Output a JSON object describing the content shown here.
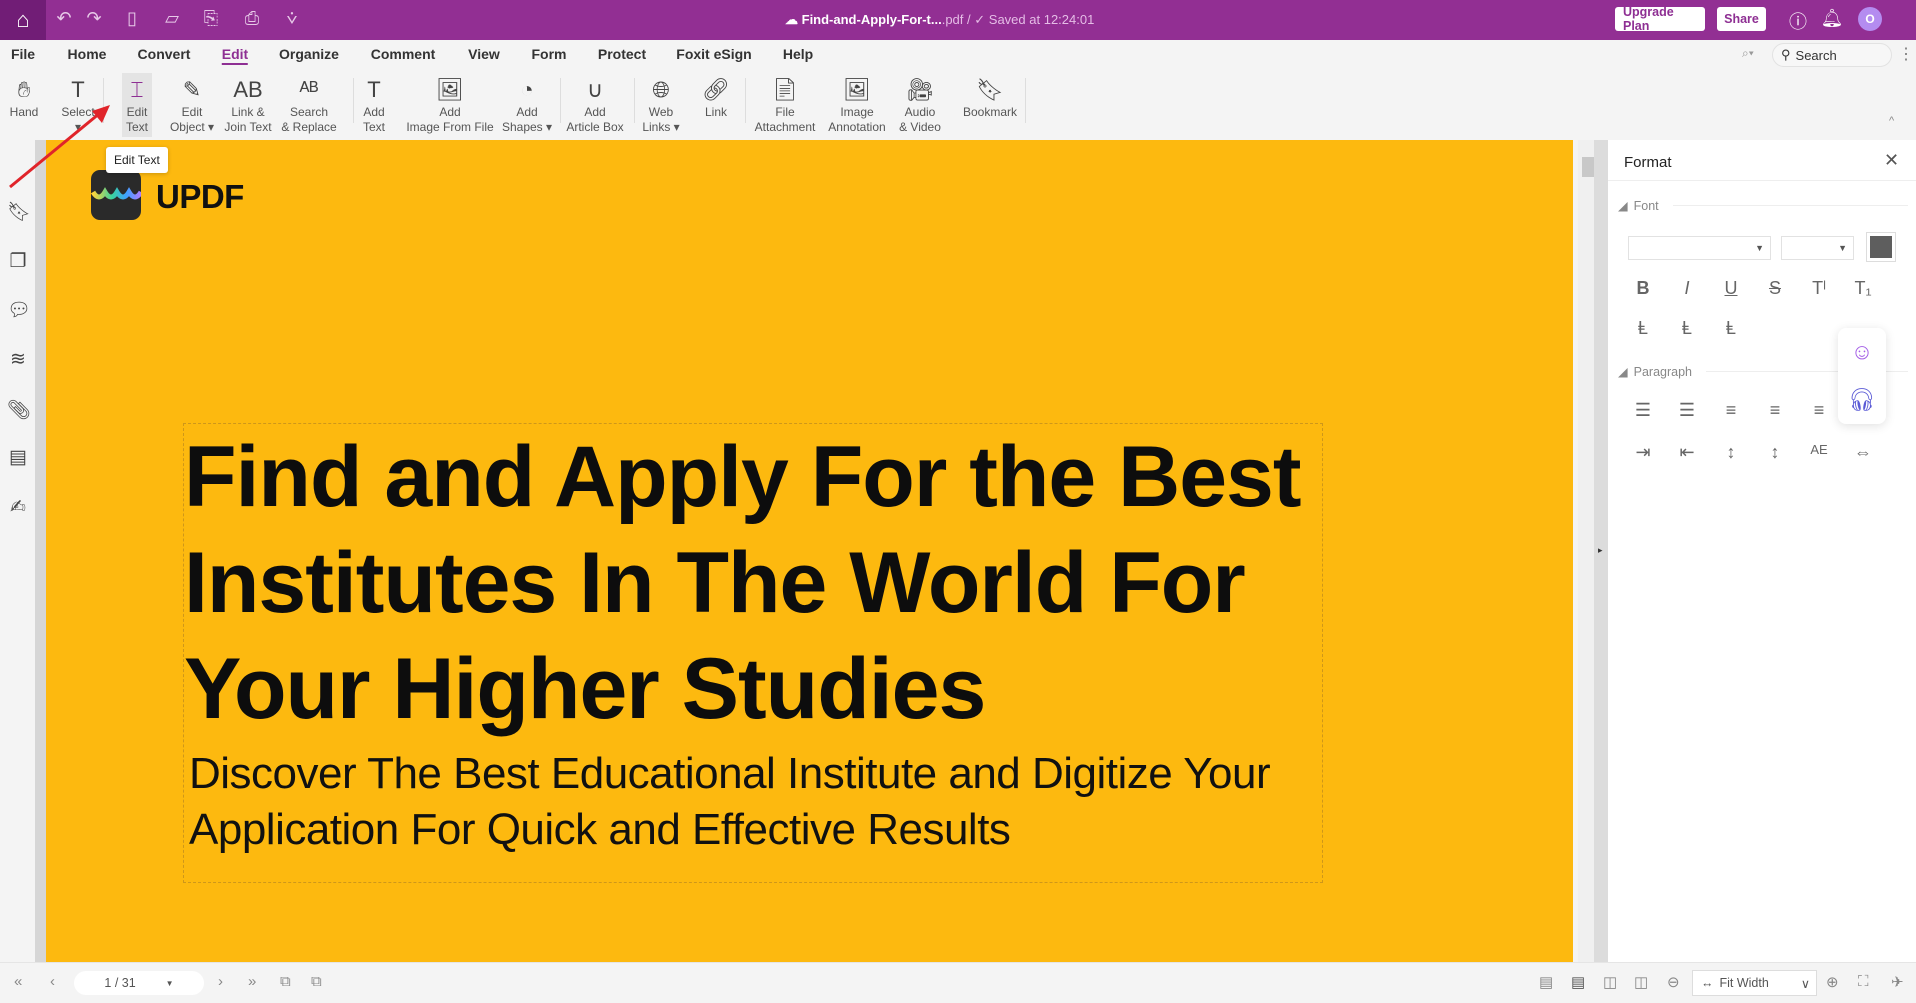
{
  "titlebar": {
    "file_name": "Find-and-Apply-For-t...",
    "file_ext": ".pdf /",
    "saved_status": "Saved at 12:24:01",
    "upgrade_label": "Upgrade Plan",
    "share_label": "Share",
    "avatar_initial": "O"
  },
  "menu": [
    {
      "label": "File"
    },
    {
      "label": "Home"
    },
    {
      "label": "Convert"
    },
    {
      "label": "Edit",
      "active": true
    },
    {
      "label": "Organize"
    },
    {
      "label": "Comment"
    },
    {
      "label": "View"
    },
    {
      "label": "Form"
    },
    {
      "label": "Protect"
    },
    {
      "label": "Foxit eSign"
    },
    {
      "label": "Help"
    }
  ],
  "search": {
    "placeholder": "Search"
  },
  "ribbon": [
    {
      "line1": "Hand",
      "line2": "",
      "icon": "hand-icon"
    },
    {
      "line1": "Select",
      "line2": "▾",
      "icon": "select-text-icon"
    },
    {
      "line1": "Edit",
      "line2": "Text",
      "icon": "edit-text-icon",
      "active": true
    },
    {
      "line1": "Edit",
      "line2": "Object ▾",
      "icon": "edit-object-icon"
    },
    {
      "line1": "Link &",
      "line2": "Join Text",
      "icon": "link-join-icon"
    },
    {
      "line1": "Search",
      "line2": "& Replace",
      "icon": "search-replace-icon"
    },
    {
      "line1": "Add",
      "line2": "Text",
      "icon": "add-text-icon"
    },
    {
      "line1": "Add",
      "line2": "Image From File",
      "icon": "add-image-icon"
    },
    {
      "line1": "Add",
      "line2": "Shapes ▾",
      "icon": "add-shapes-icon"
    },
    {
      "line1": "Add",
      "line2": "Article Box",
      "icon": "article-box-icon"
    },
    {
      "line1": "Web",
      "line2": "Links ▾",
      "icon": "web-links-icon"
    },
    {
      "line1": "Link",
      "line2": "",
      "icon": "link-icon"
    },
    {
      "line1": "File",
      "line2": "Attachment",
      "icon": "file-attachment-icon"
    },
    {
      "line1": "Image",
      "line2": "Annotation",
      "icon": "image-annotation-icon"
    },
    {
      "line1": "Audio",
      "line2": "& Video",
      "icon": "audio-video-icon"
    },
    {
      "line1": "Bookmark",
      "line2": "",
      "icon": "bookmark-icon"
    }
  ],
  "tooltip": "Edit Text",
  "document": {
    "logo_text": "UPDF",
    "heading": "Find and Apply For the Best Institutes In The World For Your Higher Studies",
    "subheading": "Discover The Best Educational Institute and Digitize Your Application For Quick and Effective Results",
    "background_color": "#fdb90f"
  },
  "format_panel": {
    "title": "Format",
    "font_section": "Font",
    "paragraph_section": "Paragraph",
    "font_color": "#5e5e5e"
  },
  "bottombar": {
    "page_indicator": "1 / 31",
    "zoom_mode": "Fit Width"
  }
}
